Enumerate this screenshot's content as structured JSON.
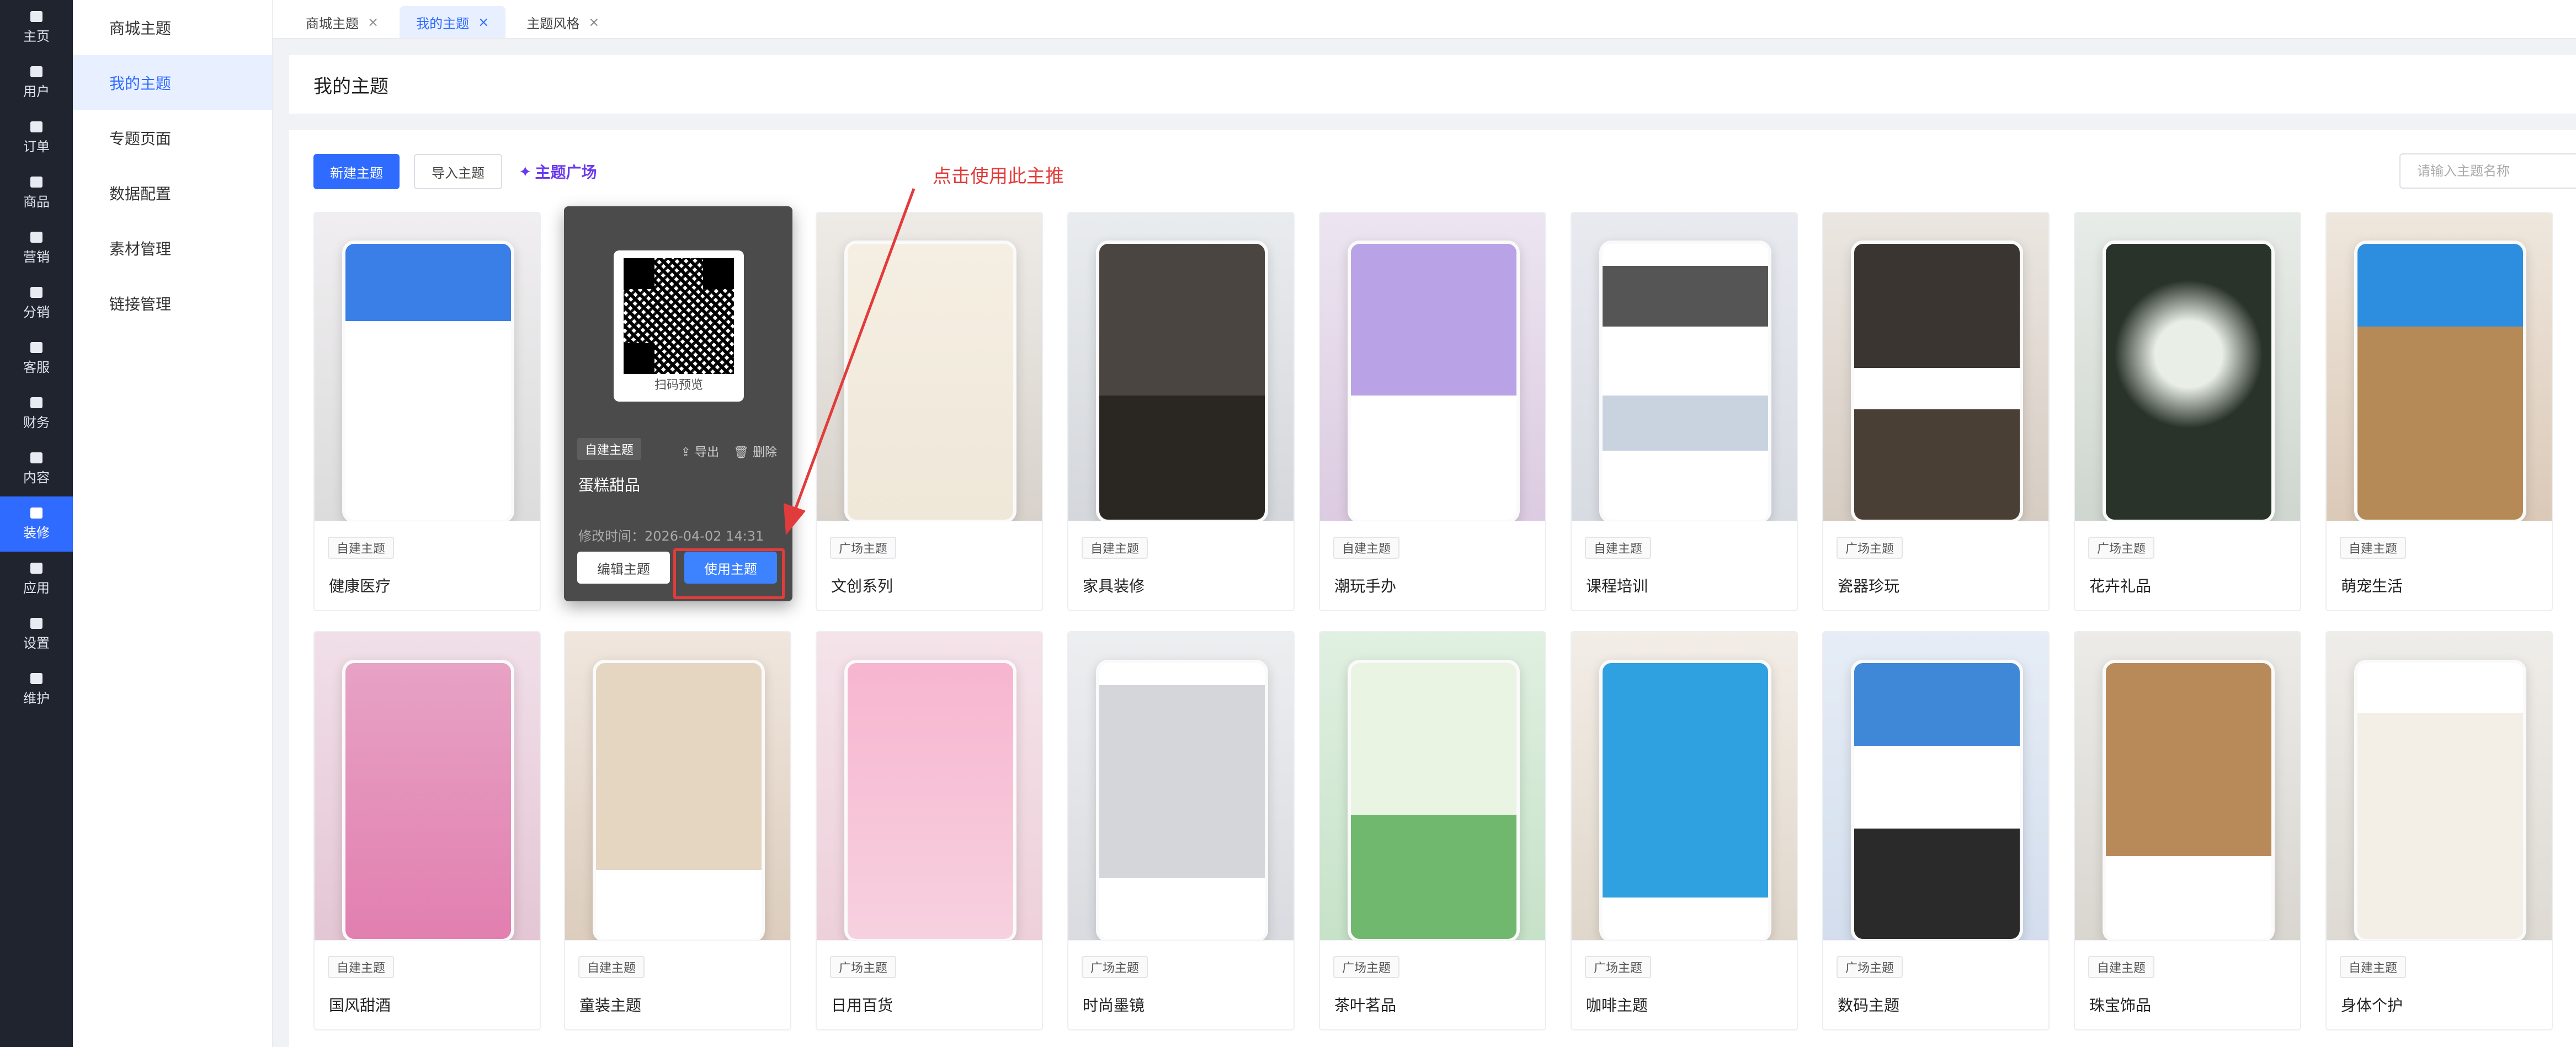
{
  "nav_rail": [
    {
      "label": "主页",
      "icon": "home-icon"
    },
    {
      "label": "用户",
      "icon": "user-icon"
    },
    {
      "label": "订单",
      "icon": "order-icon"
    },
    {
      "label": "商品",
      "icon": "goods-icon"
    },
    {
      "label": "营销",
      "icon": "marketing-icon"
    },
    {
      "label": "分销",
      "icon": "distribution-icon"
    },
    {
      "label": "客服",
      "icon": "service-icon"
    },
    {
      "label": "财务",
      "icon": "finance-icon"
    },
    {
      "label": "内容",
      "icon": "content-icon"
    },
    {
      "label": "装修",
      "icon": "decorate-icon"
    },
    {
      "label": "应用",
      "icon": "apps-icon"
    },
    {
      "label": "设置",
      "icon": "settings-icon"
    },
    {
      "label": "维护",
      "icon": "maintain-icon"
    }
  ],
  "sub_nav": [
    "商城主题",
    "我的主题",
    "专题页面",
    "数据配置",
    "素材管理",
    "链接管理"
  ],
  "tabs": [
    {
      "label": "商城主题",
      "close": "×"
    },
    {
      "label": "我的主题",
      "close": "×"
    },
    {
      "label": "主题风格",
      "close": "×"
    }
  ],
  "page_title": "我的主题",
  "toolbar": {
    "new_label": "新建主题",
    "import_label": "导入主题",
    "plaza_label": "主题广场",
    "plaza_icon": "✦",
    "search_placeholder": "请输入主题名称"
  },
  "annotation_text": "点击使用此主推",
  "hover_card": {
    "qr_label": "扫码预览",
    "tag": "自建主题",
    "export_label": "导出",
    "delete_label": "删除",
    "name": "蛋糕甜品",
    "time": "修改时间：2026-04-02 14:31",
    "edit_label": "编辑主题",
    "use_label": "使用主题"
  },
  "cards_row1": [
    {
      "tag": "自建主题",
      "name": "健康医疗"
    },
    {
      "tag": "广场主题",
      "name": "文创系列"
    },
    {
      "tag": "自建主题",
      "name": "家具装修"
    },
    {
      "tag": "自建主题",
      "name": "潮玩手办"
    },
    {
      "tag": "自建主题",
      "name": "课程培训"
    },
    {
      "tag": "广场主题",
      "name": "瓷器珍玩"
    },
    {
      "tag": "广场主题",
      "name": "花卉礼品"
    },
    {
      "tag": "自建主题",
      "name": "萌宠生活"
    }
  ],
  "cards_row2": [
    {
      "tag": "自建主题",
      "name": "国风甜酒"
    },
    {
      "tag": "自建主题",
      "name": "童装主题"
    },
    {
      "tag": "广场主题",
      "name": "日用百货"
    },
    {
      "tag": "广场主题",
      "name": "时尚墨镜"
    },
    {
      "tag": "广场主题",
      "name": "茶叶茗品"
    },
    {
      "tag": "广场主题",
      "name": "咖啡主题"
    },
    {
      "tag": "广场主题",
      "name": "数码主题"
    },
    {
      "tag": "自建主题",
      "name": "珠宝饰品"
    },
    {
      "tag": "自建主题",
      "name": "身体个护"
    }
  ]
}
